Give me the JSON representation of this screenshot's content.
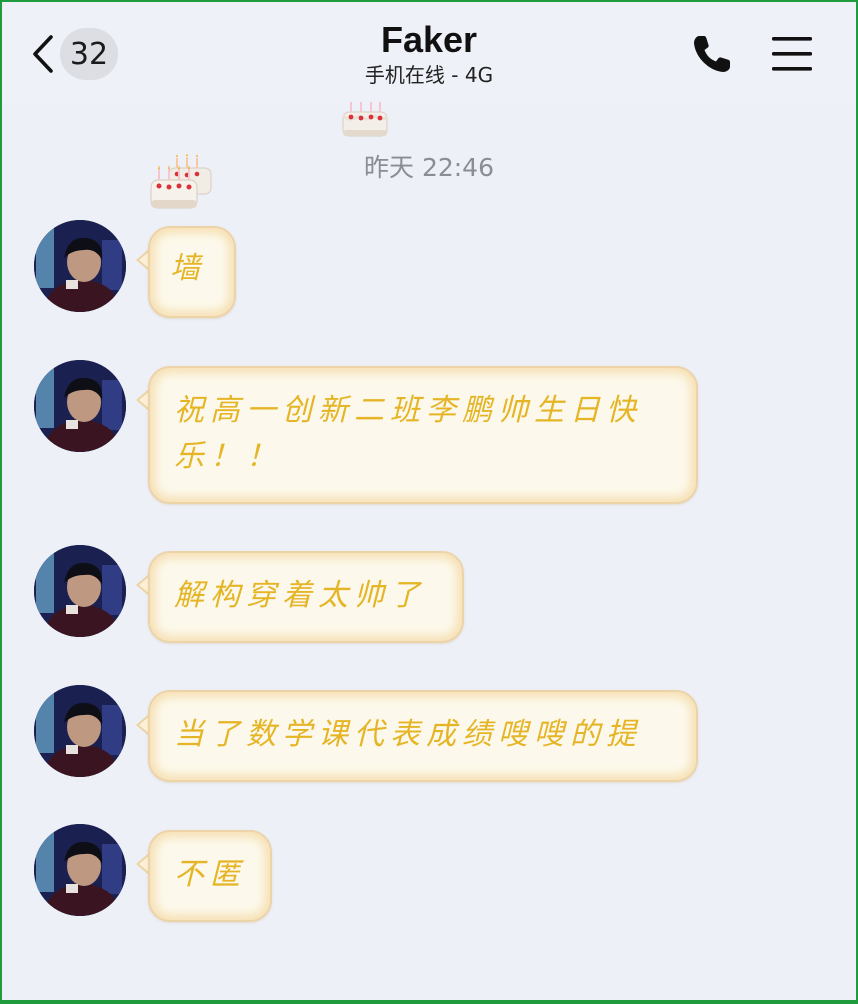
{
  "header": {
    "back_count": "32",
    "contact_name": "Faker",
    "status": "手机在线 - 4G",
    "phone_icon": "phone-icon",
    "menu_icon": "menu-icon"
  },
  "stickers": {
    "top": "birthday-cake-emoji",
    "multi": "birthday-cakes-emoji"
  },
  "timestamp": "昨天 22:46",
  "messages": [
    {
      "text": "墙"
    },
    {
      "text": "祝高一创新二班李鹏帅生日快乐！！"
    },
    {
      "text": "解构穿着太帅了"
    },
    {
      "text": "当了数学课代表成绩嗖嗖的提"
    },
    {
      "text": "不匿"
    }
  ],
  "colors": {
    "bubble_text": "#e5b526",
    "bubble_bg": "#fcf9ec",
    "bubble_border": "#ecd3a8",
    "page_bg": "#edf0f7",
    "frame": "#1f9a3c"
  }
}
